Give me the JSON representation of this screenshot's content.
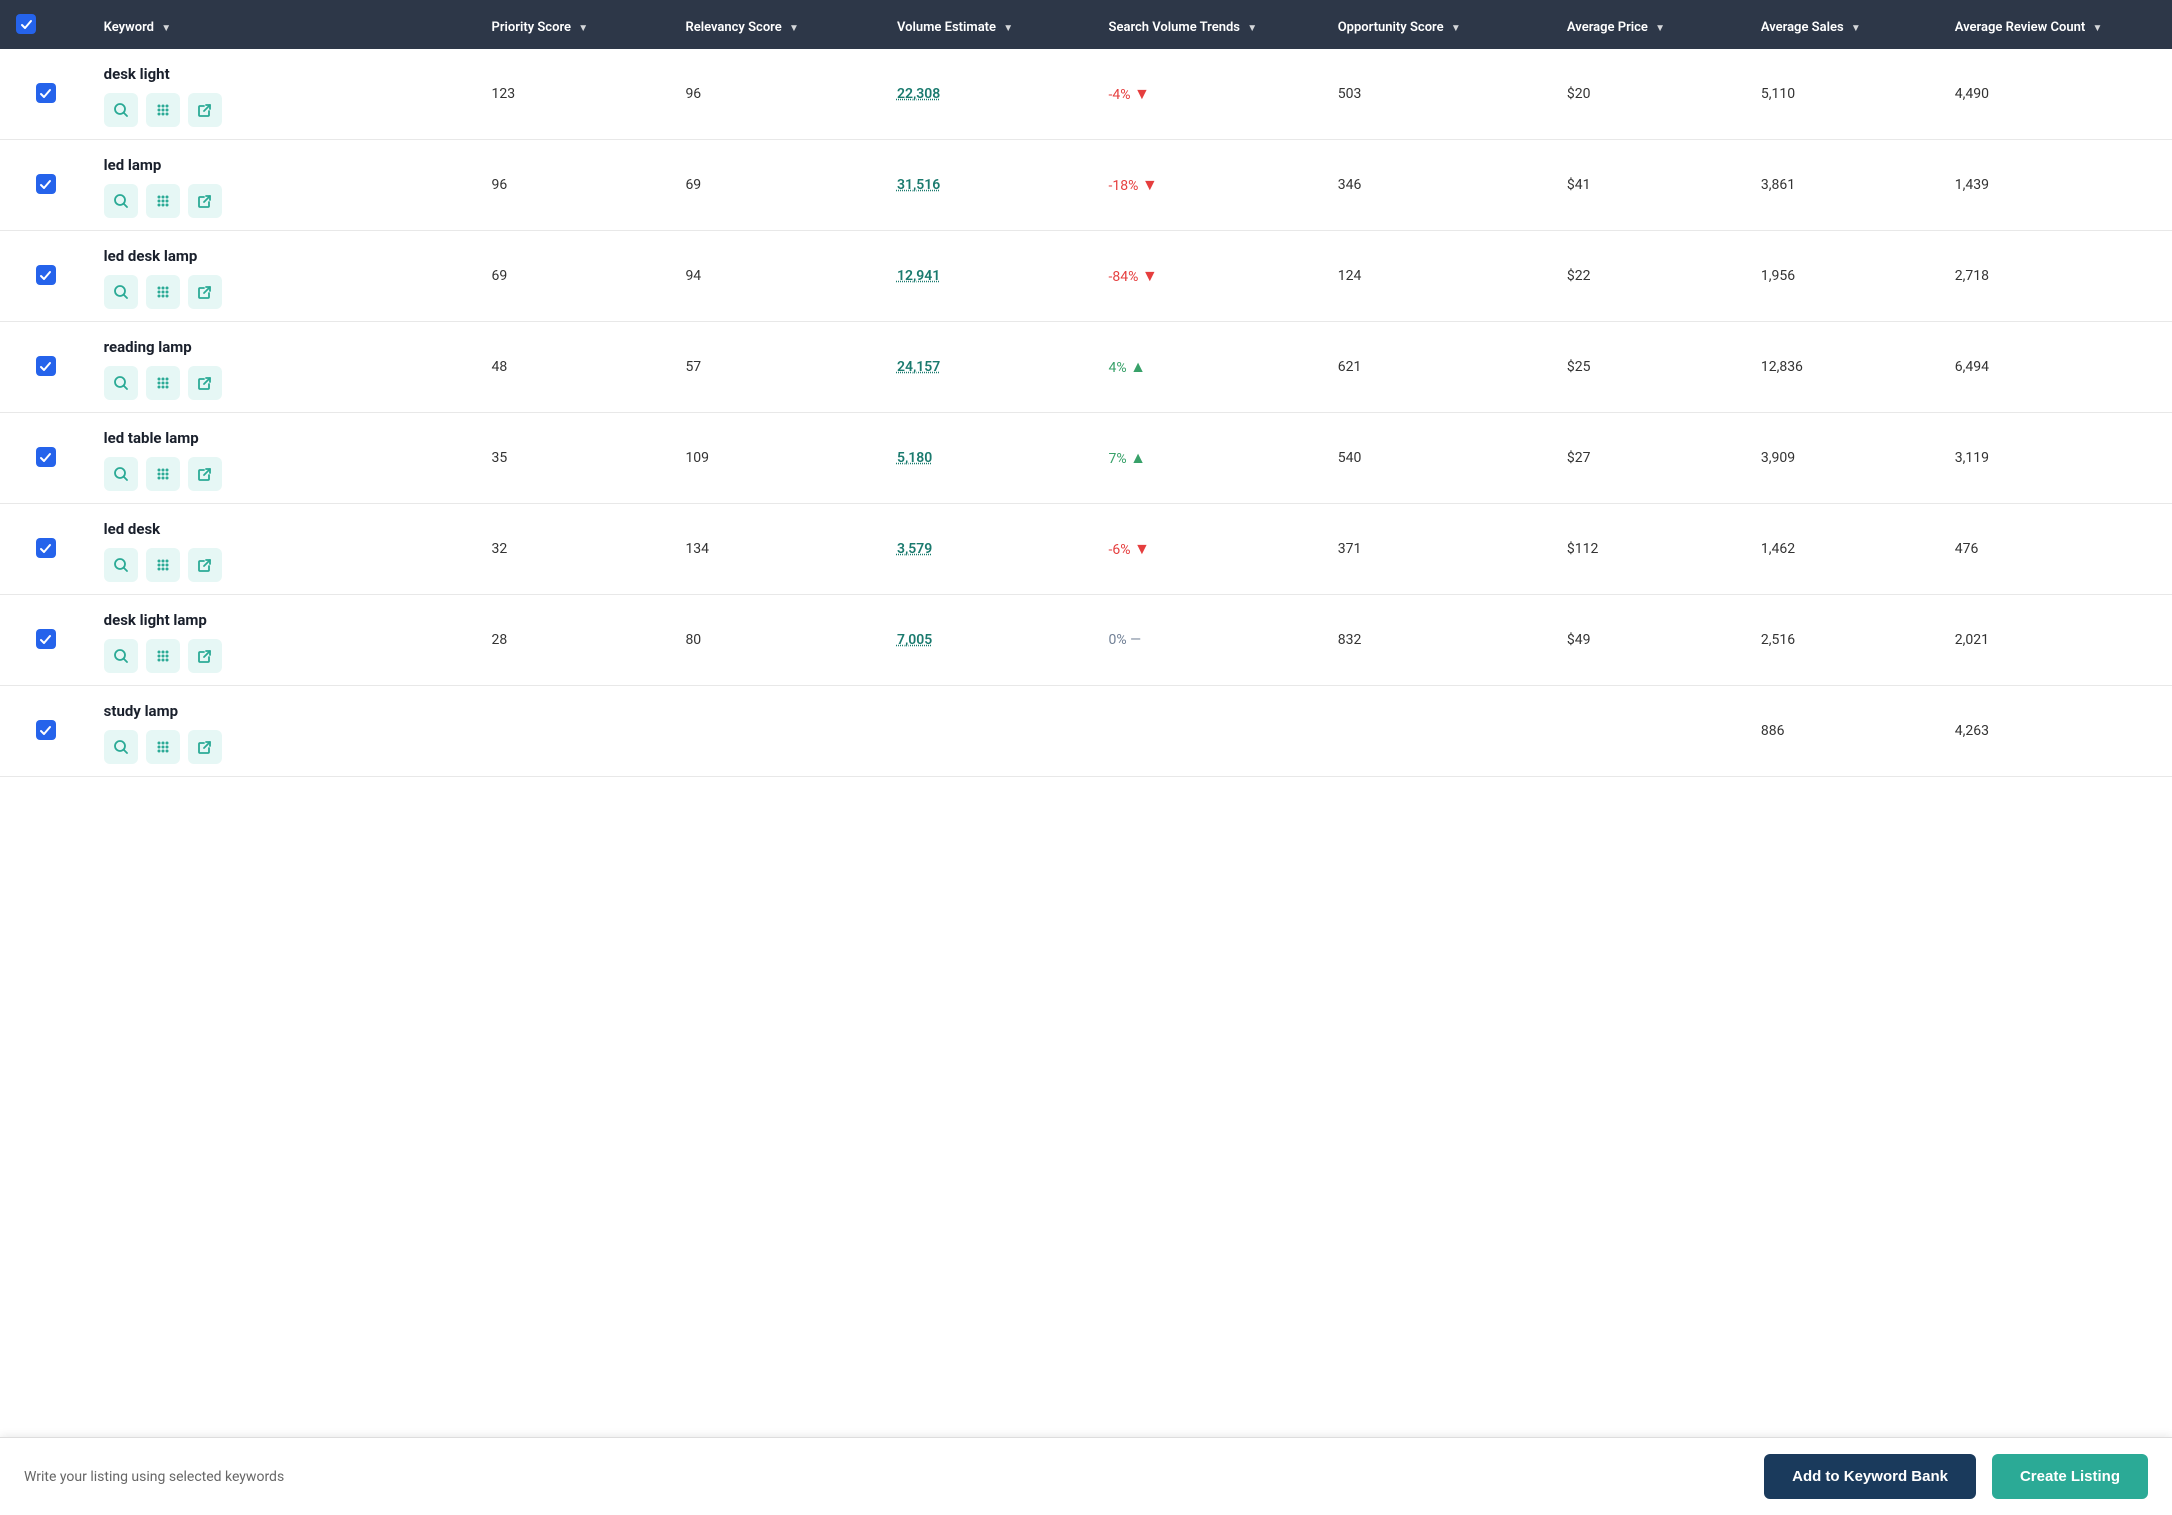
{
  "colors": {
    "header_bg": "#2d3748",
    "checkbox_bg": "#2563eb",
    "teal": "#2baa96",
    "link_color": "#1a7a6e",
    "down_color": "#e53e3e",
    "up_color": "#38a169"
  },
  "header": {
    "checkbox_label": "Select All",
    "columns": [
      {
        "key": "keyword",
        "label": "Keyword",
        "sortable": true
      },
      {
        "key": "priority",
        "label": "Priority Score",
        "sortable": true
      },
      {
        "key": "relevancy",
        "label": "Relevancy Score",
        "sortable": true
      },
      {
        "key": "volume",
        "label": "Volume Estimate",
        "sortable": true
      },
      {
        "key": "search_trend",
        "label": "Search Volume Trends",
        "sortable": true
      },
      {
        "key": "opportunity",
        "label": "Opportunity Score",
        "sortable": true
      },
      {
        "key": "avg_price",
        "label": "Average Price",
        "sortable": true
      },
      {
        "key": "avg_sales",
        "label": "Average Sales",
        "sortable": true
      },
      {
        "key": "avg_review",
        "label": "Average Review Count",
        "sortable": true
      }
    ]
  },
  "rows": [
    {
      "id": 1,
      "checked": true,
      "keyword": "desk light",
      "priority_score": "123",
      "relevancy_score": "96",
      "volume_estimate": "22,308",
      "search_trend_pct": "-4%",
      "search_trend_dir": "down",
      "opportunity_score": "503",
      "avg_price": "$20",
      "avg_sales": "5,110",
      "avg_review_count": "4,490"
    },
    {
      "id": 2,
      "checked": true,
      "keyword": "led lamp",
      "priority_score": "96",
      "relevancy_score": "69",
      "volume_estimate": "31,516",
      "search_trend_pct": "-18%",
      "search_trend_dir": "down",
      "opportunity_score": "346",
      "avg_price": "$41",
      "avg_sales": "3,861",
      "avg_review_count": "1,439"
    },
    {
      "id": 3,
      "checked": true,
      "keyword": "led desk lamp",
      "priority_score": "69",
      "relevancy_score": "94",
      "volume_estimate": "12,941",
      "search_trend_pct": "-84%",
      "search_trend_dir": "down",
      "opportunity_score": "124",
      "avg_price": "$22",
      "avg_sales": "1,956",
      "avg_review_count": "2,718"
    },
    {
      "id": 4,
      "checked": true,
      "keyword": "reading lamp",
      "priority_score": "48",
      "relevancy_score": "57",
      "volume_estimate": "24,157",
      "search_trend_pct": "4%",
      "search_trend_dir": "up",
      "opportunity_score": "621",
      "avg_price": "$25",
      "avg_sales": "12,836",
      "avg_review_count": "6,494"
    },
    {
      "id": 5,
      "checked": true,
      "keyword": "led table lamp",
      "priority_score": "35",
      "relevancy_score": "109",
      "volume_estimate": "5,180",
      "search_trend_pct": "7%",
      "search_trend_dir": "up",
      "opportunity_score": "540",
      "avg_price": "$27",
      "avg_sales": "3,909",
      "avg_review_count": "3,119"
    },
    {
      "id": 6,
      "checked": true,
      "keyword": "led desk",
      "priority_score": "32",
      "relevancy_score": "134",
      "volume_estimate": "3,579",
      "search_trend_pct": "-6%",
      "search_trend_dir": "down",
      "opportunity_score": "371",
      "avg_price": "$112",
      "avg_sales": "1,462",
      "avg_review_count": "476"
    },
    {
      "id": 7,
      "checked": true,
      "keyword": "desk light lamp",
      "priority_score": "28",
      "relevancy_score": "80",
      "volume_estimate": "7,005",
      "search_trend_pct": "0%",
      "search_trend_dir": "neutral",
      "opportunity_score": "832",
      "avg_price": "$49",
      "avg_sales": "2,516",
      "avg_review_count": "2,021"
    },
    {
      "id": 8,
      "checked": true,
      "keyword": "study lamp",
      "priority_score": "",
      "relevancy_score": "",
      "volume_estimate": "",
      "search_trend_pct": "",
      "search_trend_dir": "neutral",
      "opportunity_score": "",
      "avg_price": "",
      "avg_sales": "886",
      "avg_review_count": "4,263"
    }
  ],
  "bottom_bar": {
    "message": "Write your listing using selected keywords",
    "btn_keyword_bank": "Add to Keyword Bank",
    "btn_create_listing": "Create Listing"
  },
  "icons": {
    "search": "🔍",
    "grid": "⠿",
    "external": "↗"
  }
}
